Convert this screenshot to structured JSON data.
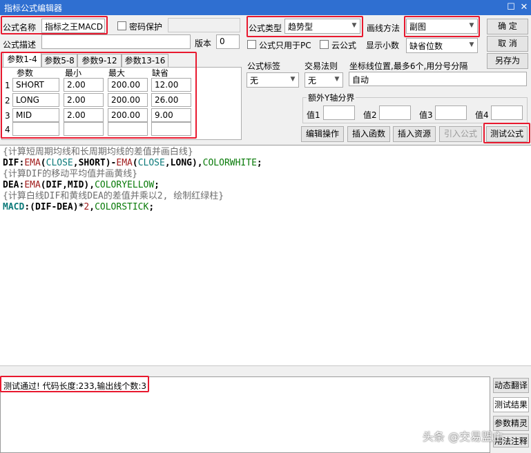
{
  "window": {
    "title": "指标公式编辑器",
    "restore_glyph": "☐",
    "close_glyph": "✕"
  },
  "form": {
    "name_label": "公式名称",
    "name_value": "指标之王MACD",
    "password_label": "密码保护",
    "desc_label": "公式描述",
    "desc_value": "",
    "version_label": "版本",
    "version_value": "0",
    "type_label": "公式类型",
    "type_value": "趋势型",
    "draw_label": "画线方法",
    "draw_value": "副图",
    "pc_only_label": "公式只用于PC",
    "cloud_label": "云公式",
    "decimals_label": "显示小数",
    "decimals_value": "缺省位数",
    "confirm_button": "确 定",
    "cancel_button": "取 消",
    "saveas_button": "另存为",
    "formula_tag_label": "公式标签",
    "formula_tag_value": "无",
    "trade_rule_label": "交易法则",
    "trade_rule_value": "无",
    "axis_label": "坐标线位置,最多6个,用分号分隔",
    "axis_value": "自动",
    "y_boundary_label": "额外Y轴分界",
    "y_values": [
      {
        "label": "值1"
      },
      {
        "label": "值2"
      },
      {
        "label": "值3"
      },
      {
        "label": "值4"
      }
    ],
    "edit_ops_button": "编辑操作",
    "insert_fn_button": "插入函数",
    "insert_res_button": "插入资源",
    "import_button": "引入公式",
    "test_button": "测试公式"
  },
  "params": {
    "tabs": [
      "参数1-4",
      "参数5-8",
      "参数9-12",
      "参数13-16"
    ],
    "headers": [
      "参数",
      "最小",
      "最大",
      "缺省"
    ],
    "rows": [
      {
        "idx": "1",
        "name": "SHORT",
        "min": "2.00",
        "max": "200.00",
        "def": "12.00"
      },
      {
        "idx": "2",
        "name": "LONG",
        "min": "2.00",
        "max": "200.00",
        "def": "26.00"
      },
      {
        "idx": "3",
        "name": "MID",
        "min": "2.00",
        "max": "200.00",
        "def": "9.00"
      },
      {
        "idx": "4",
        "name": "",
        "min": "",
        "max": "",
        "def": ""
      }
    ]
  },
  "code": {
    "c1": "{计算短周期均线和长周期均线的差值并画白线}",
    "l1": [
      "DIF",
      ":",
      "EMA",
      "(",
      "CLOSE",
      ",SHORT)-",
      "EMA",
      "(",
      "CLOSE",
      ",LONG),",
      "COLORWHITE",
      ";"
    ],
    "c2": "{计算DIF的移动平均值并画黄线}",
    "l2": [
      "DEA",
      ":",
      "EMA",
      "(DIF,MID),",
      "COLORYELLOW",
      ";"
    ],
    "c3": "{计算白线DIF和黄线DEA的差值并乘以2, 绘制红绿柱}",
    "l3": [
      "MACD",
      ":(DIF-DEA)*",
      "2",
      ",",
      "COLORSTICK",
      ";"
    ]
  },
  "output": {
    "message": "测试通过! 代码长度:233,输出线个数:3"
  },
  "side_tabs": [
    "动态翻译",
    "测试结果",
    "参数精灵",
    "用法注释"
  ],
  "watermark": "头条 @交易盟主",
  "colors": {
    "title_bar": "#2f6fd1",
    "highlight": "#e8182e"
  }
}
